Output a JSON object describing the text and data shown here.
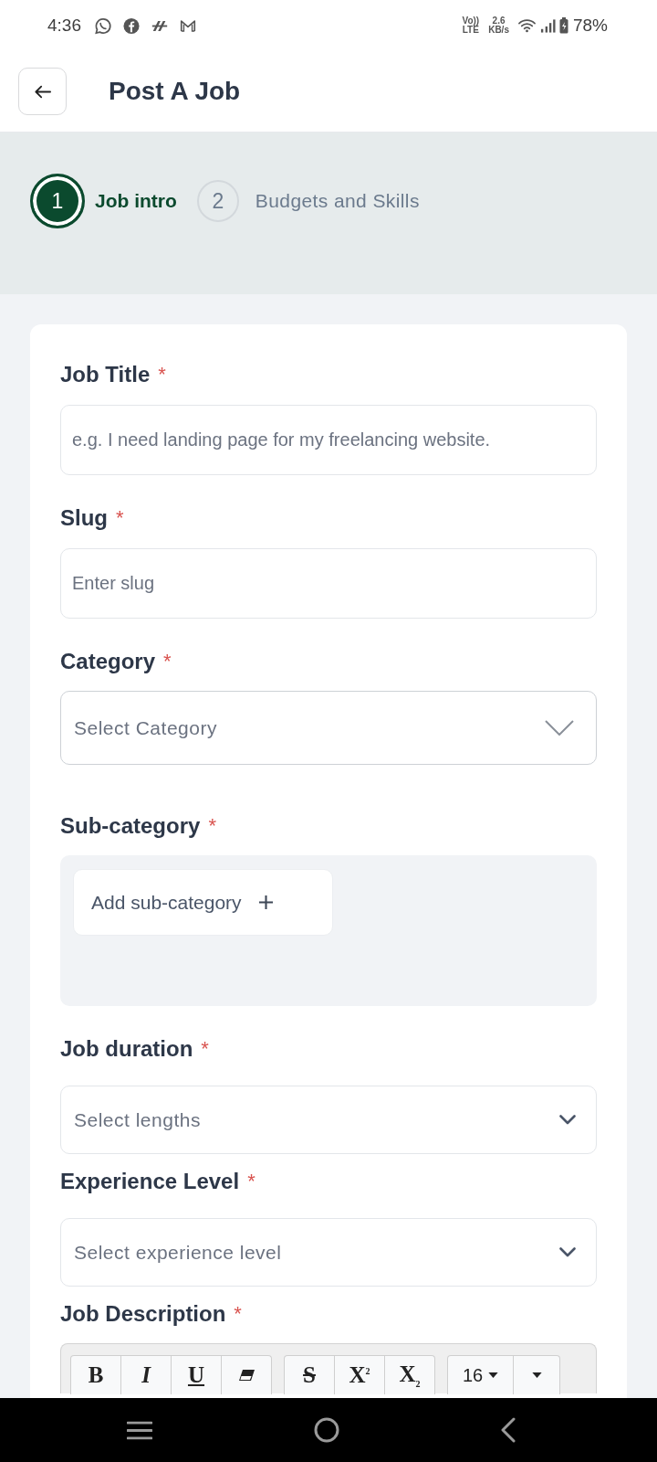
{
  "status_bar": {
    "time": "4:36",
    "volte": [
      "Vo))",
      "LTE"
    ],
    "net_speed": [
      "2.6",
      "KB/s"
    ],
    "battery": "78%"
  },
  "header": {
    "title": "Post A Job"
  },
  "steps": [
    {
      "number": "1",
      "label": "Job intro",
      "selected": true
    },
    {
      "number": "2",
      "label": "Budgets and Skills",
      "selected": false
    }
  ],
  "fields": [
    {
      "kind": "text",
      "label": "Job Title",
      "required_mark": "*",
      "placeholder": "e.g. I need landing page for my freelancing website."
    },
    {
      "kind": "text",
      "label": "Slug",
      "required_mark": "*",
      "placeholder": "Enter slug"
    },
    {
      "kind": "select",
      "label": "Category",
      "required_mark": "*",
      "placeholder": "Select Category"
    },
    {
      "kind": "tags",
      "label": "Sub-category",
      "required_mark": "*",
      "button": "Add sub-category"
    },
    {
      "kind": "dropdown",
      "label": "Job duration",
      "required_mark": "*",
      "placeholder": "Select lengths"
    },
    {
      "kind": "dropdown",
      "label": "Experience Level",
      "required_mark": "*",
      "placeholder": "Select experience level"
    },
    {
      "kind": "editor",
      "label": "Job Description",
      "required_mark": "*",
      "toolbar": [
        [
          {
            "kind": "bold",
            "label": "B"
          },
          {
            "kind": "italic",
            "label": "I"
          },
          {
            "kind": "underline",
            "label": "U"
          },
          {
            "kind": "eraser"
          }
        ],
        [
          {
            "kind": "strike",
            "label": "S"
          },
          {
            "kind": "superscript",
            "label": "X$^{2}$"
          },
          {
            "kind": "subscript",
            "label": "X$_{2}$"
          }
        ],
        [
          {
            "kind": "font-size",
            "label": "16"
          },
          {
            "kind": "more"
          }
        ]
      ]
    }
  ]
}
